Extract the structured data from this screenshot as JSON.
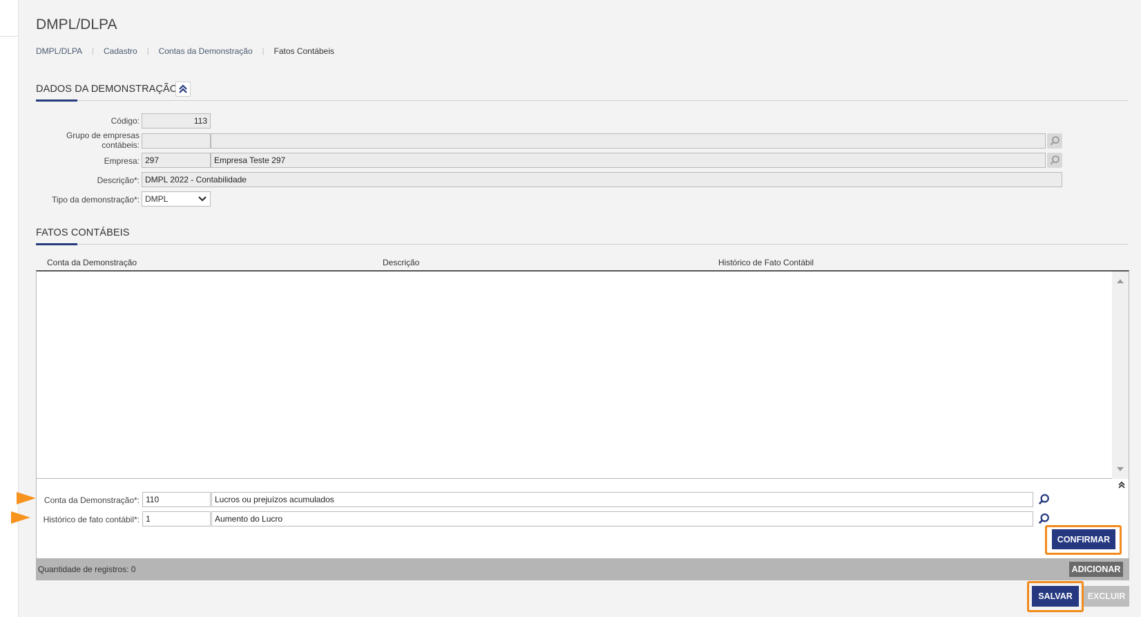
{
  "page": {
    "title": "DMPL/DLPA"
  },
  "breadcrumb": [
    "DMPL/DLPA",
    "Cadastro",
    "Contas da Demonstração",
    "Fatos Contábeis"
  ],
  "dados": {
    "section_title": "DADOS DA DEMONSTRAÇÃO",
    "codigo_label": "Código:",
    "codigo_value": "113",
    "grupo_label_line1": "Grupo de empresas",
    "grupo_label_line2": "contábeis:",
    "grupo_code": "",
    "grupo_name": "",
    "empresa_label": "Empresa:",
    "empresa_code": "297",
    "empresa_name": "Empresa Teste 297",
    "descricao_label": "Descrição*:",
    "descricao_value": "DMPL 2022 - Contabilidade",
    "tipo_label": "Tipo da demonstração*:",
    "tipo_value": "DMPL"
  },
  "fatos": {
    "section_title": "FATOS CONTÁBEIS",
    "columns": [
      "Conta da Demonstração",
      "Descrição",
      "Histórico de Fato Contábil"
    ],
    "rows": [],
    "conta_label": "Conta da Demonstração*:",
    "conta_code": "110",
    "conta_name": "Lucros ou prejuízos acumulados",
    "historico_label": "Histórico de fato contábil*:",
    "historico_code": "1",
    "historico_name": "Aumento do Lucro",
    "confirm_label": "CONFIRMAR",
    "count_text": "Quantidade de registros: 0",
    "add_label": "ADICIONAR"
  },
  "actions": {
    "save_label": "SALVAR",
    "delete_label": "EXCLUIR"
  },
  "colors": {
    "accent": "#253880",
    "highlight": "#f28a1c",
    "arrow": "#f7931e"
  },
  "icons": {
    "collapse": "double-chevron-up-icon",
    "search": "magnifier-icon",
    "dropdown": "chevron-down-icon"
  }
}
